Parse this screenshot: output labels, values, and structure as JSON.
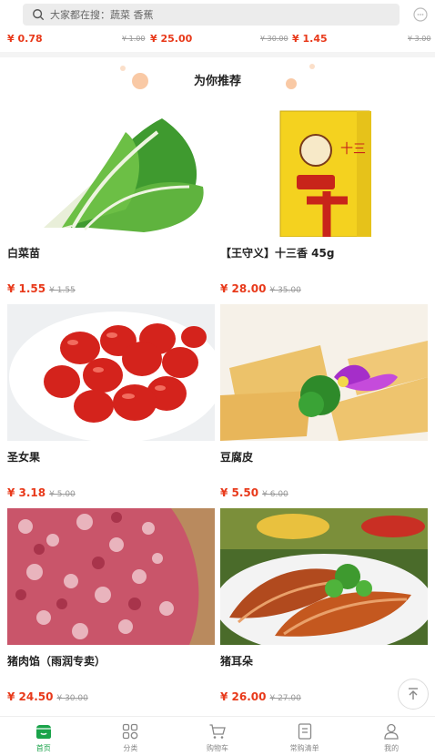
{
  "search": {
    "placeholder": "大家都在搜：蔬菜 香蕉"
  },
  "strip": [
    {
      "price": "¥ 0.78"
    },
    {
      "old": "¥ 1.00",
      "price": "¥ 25.00"
    },
    {
      "old": "¥ 30.00",
      "price": "¥ 1.45"
    },
    {
      "old": "¥ 3.00"
    }
  ],
  "section": {
    "title": "为你推荐"
  },
  "products": [
    {
      "name": "白菜苗",
      "price": "¥ 1.55",
      "old": "¥ 1.55"
    },
    {
      "name": "【王守义】十三香 45g",
      "price": "¥ 28.00",
      "old": "¥ 35.00"
    },
    {
      "name": "圣女果",
      "price": "¥ 3.18",
      "old": "¥ 5.00"
    },
    {
      "name": "豆腐皮",
      "price": "¥ 5.50",
      "old": "¥ 6.00"
    },
    {
      "name": "猪肉馅（雨润专卖）",
      "price": "¥ 24.50",
      "old": "¥ 30.00"
    },
    {
      "name": "猪耳朵",
      "price": "¥ 26.00",
      "old": "¥ 27.00"
    }
  ],
  "tabs": [
    {
      "label": "首页",
      "icon": "home-icon",
      "active": true
    },
    {
      "label": "分类",
      "icon": "category-icon"
    },
    {
      "label": "购物车",
      "icon": "cart-icon"
    },
    {
      "label": "常购清单",
      "icon": "list-icon"
    },
    {
      "label": "我的",
      "icon": "user-icon"
    }
  ],
  "colors": {
    "price_red": "#e8391a",
    "active_green": "#1aa34a"
  }
}
